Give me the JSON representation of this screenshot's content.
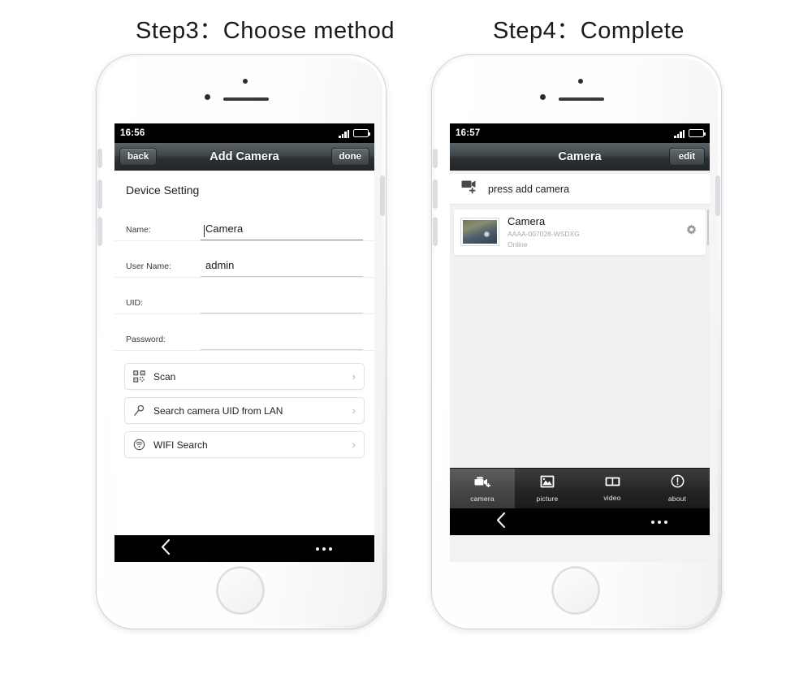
{
  "steps": [
    {
      "title": "Step3：Choose method"
    },
    {
      "title": "Step4：Complete"
    }
  ],
  "phone1": {
    "statusbar": {
      "time": "16:56",
      "signal_icon": "signal-bars-icon",
      "battery_icon": "battery-icon"
    },
    "navbar": {
      "back_label": "back",
      "title": "Add Camera",
      "done_label": "done"
    },
    "section_title": "Device Setting",
    "fields": [
      {
        "label": "Name:",
        "value": "Camera",
        "placeholder": "",
        "focused": true
      },
      {
        "label": "User Name:",
        "value": "admin",
        "placeholder": "",
        "focused": false
      },
      {
        "label": "UID:",
        "value": "",
        "placeholder": "",
        "focused": false
      },
      {
        "label": "Password:",
        "value": "",
        "placeholder": "",
        "focused": false
      }
    ],
    "actions": [
      {
        "icon": "qr-scan-icon",
        "label": "Scan",
        "chevron": "›"
      },
      {
        "icon": "search-magnifier-icon",
        "label": "Search camera UID from LAN",
        "chevron": "›"
      },
      {
        "icon": "wifi-icon",
        "label": "WIFI Search",
        "chevron": "›"
      }
    ],
    "softkeys": {
      "back_icon": "back-chevron-icon",
      "menu_icon": "overflow-menu-icon"
    }
  },
  "phone2": {
    "statusbar": {
      "time": "16:57",
      "signal_icon": "signal-bars-icon",
      "battery_icon": "battery-icon"
    },
    "navbar": {
      "title": "Camera",
      "edit_label": "edit"
    },
    "add_row": {
      "icon": "camcorder-plus-icon",
      "label": "press add camera"
    },
    "camera_item": {
      "thumbnail": "camera-snapshot-thumbnail",
      "name": "Camera",
      "uid": "AAAA-007028-WSDXG",
      "status": "Online",
      "settings_icon": "gear-icon"
    },
    "tabs": [
      {
        "icon": "camera-tab-icon",
        "label": "camera",
        "active": true
      },
      {
        "icon": "picture-tab-icon",
        "label": "picture",
        "active": false
      },
      {
        "icon": "video-tab-icon",
        "label": "video",
        "active": false
      },
      {
        "icon": "about-tab-icon",
        "label": "about",
        "active": false
      }
    ],
    "softkeys": {
      "back_icon": "back-chevron-icon",
      "menu_icon": "overflow-menu-icon"
    }
  },
  "colors": {
    "accent_focus": "#28b5c8",
    "navbar_dark": "#3b4144",
    "background": "#ffffff",
    "screen_bg": "#f1f1f3"
  }
}
